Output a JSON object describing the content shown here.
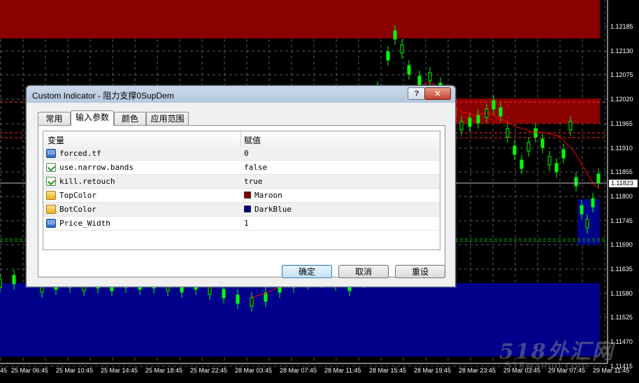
{
  "dialog": {
    "title": "Custom Indicator - 阻力支撑0SupDem",
    "help_label": "?",
    "close_label": "✕",
    "tabs": [
      {
        "label": "常用",
        "active": false
      },
      {
        "label": "输入参数",
        "active": true
      },
      {
        "label": "颜色",
        "active": false
      },
      {
        "label": "应用范围",
        "active": false
      }
    ],
    "grid": {
      "col_variable": "变量",
      "col_value": "赋值",
      "rows": [
        {
          "icon": "numeric-param-icon",
          "name": "forced.tf",
          "value": "0"
        },
        {
          "icon": "bool-param-icon",
          "name": "use.narrow.bands",
          "value": "false"
        },
        {
          "icon": "bool-param-icon",
          "name": "kill.retouch",
          "value": "true"
        },
        {
          "icon": "color-param-icon",
          "name": "TopColor",
          "value": "Maroon",
          "swatch": "#800000"
        },
        {
          "icon": "color-param-icon",
          "name": "BotColor",
          "value": "DarkBlue",
          "swatch": "#00008b"
        },
        {
          "icon": "numeric-param-icon",
          "name": "Price_Width",
          "value": "1"
        }
      ]
    },
    "buttons": {
      "ok": "确定",
      "cancel": "取消",
      "reset": "重设"
    }
  },
  "chart": {
    "price_labels": [
      "1.12185",
      "1.12130",
      "1.12075",
      "1.12020",
      "1.11965",
      "1.11910",
      "1.11855",
      "1.11800",
      "1.11745",
      "1.11690",
      "1.11635",
      "1.11580",
      "1.11525",
      "1.11470",
      "1.11415"
    ],
    "current_price": "1.11823",
    "time_labels": [
      "25 Mar 06:45",
      "25 Mar 10:45",
      "25 Mar 14:45",
      "25 Mar 18:45",
      "25 Mar 22:45",
      "28 Mar 03:45",
      "28 Mar 07:45",
      "28 Mar 11:45",
      "28 Mar 15:45",
      "28 Mar 19:45",
      "28 Mar 23:45",
      "29 Mar 03:45",
      "29 Mar 07:45"
    ],
    "time_label_left_partial": "45",
    "time_label_right_partial": "29 Mar 11:45",
    "colors": {
      "background": "#000000",
      "candles": "#00ff00",
      "supply_zone": "#8b0000",
      "demand_zone": "#00008b",
      "moving_average": "#ff0000",
      "grid": "#5a5a5a",
      "level_lines_red": "#ff3030",
      "level_lines_green": "#00c000"
    },
    "watermark": "518外汇网",
    "watermark_sub": "518waihui.com"
  }
}
